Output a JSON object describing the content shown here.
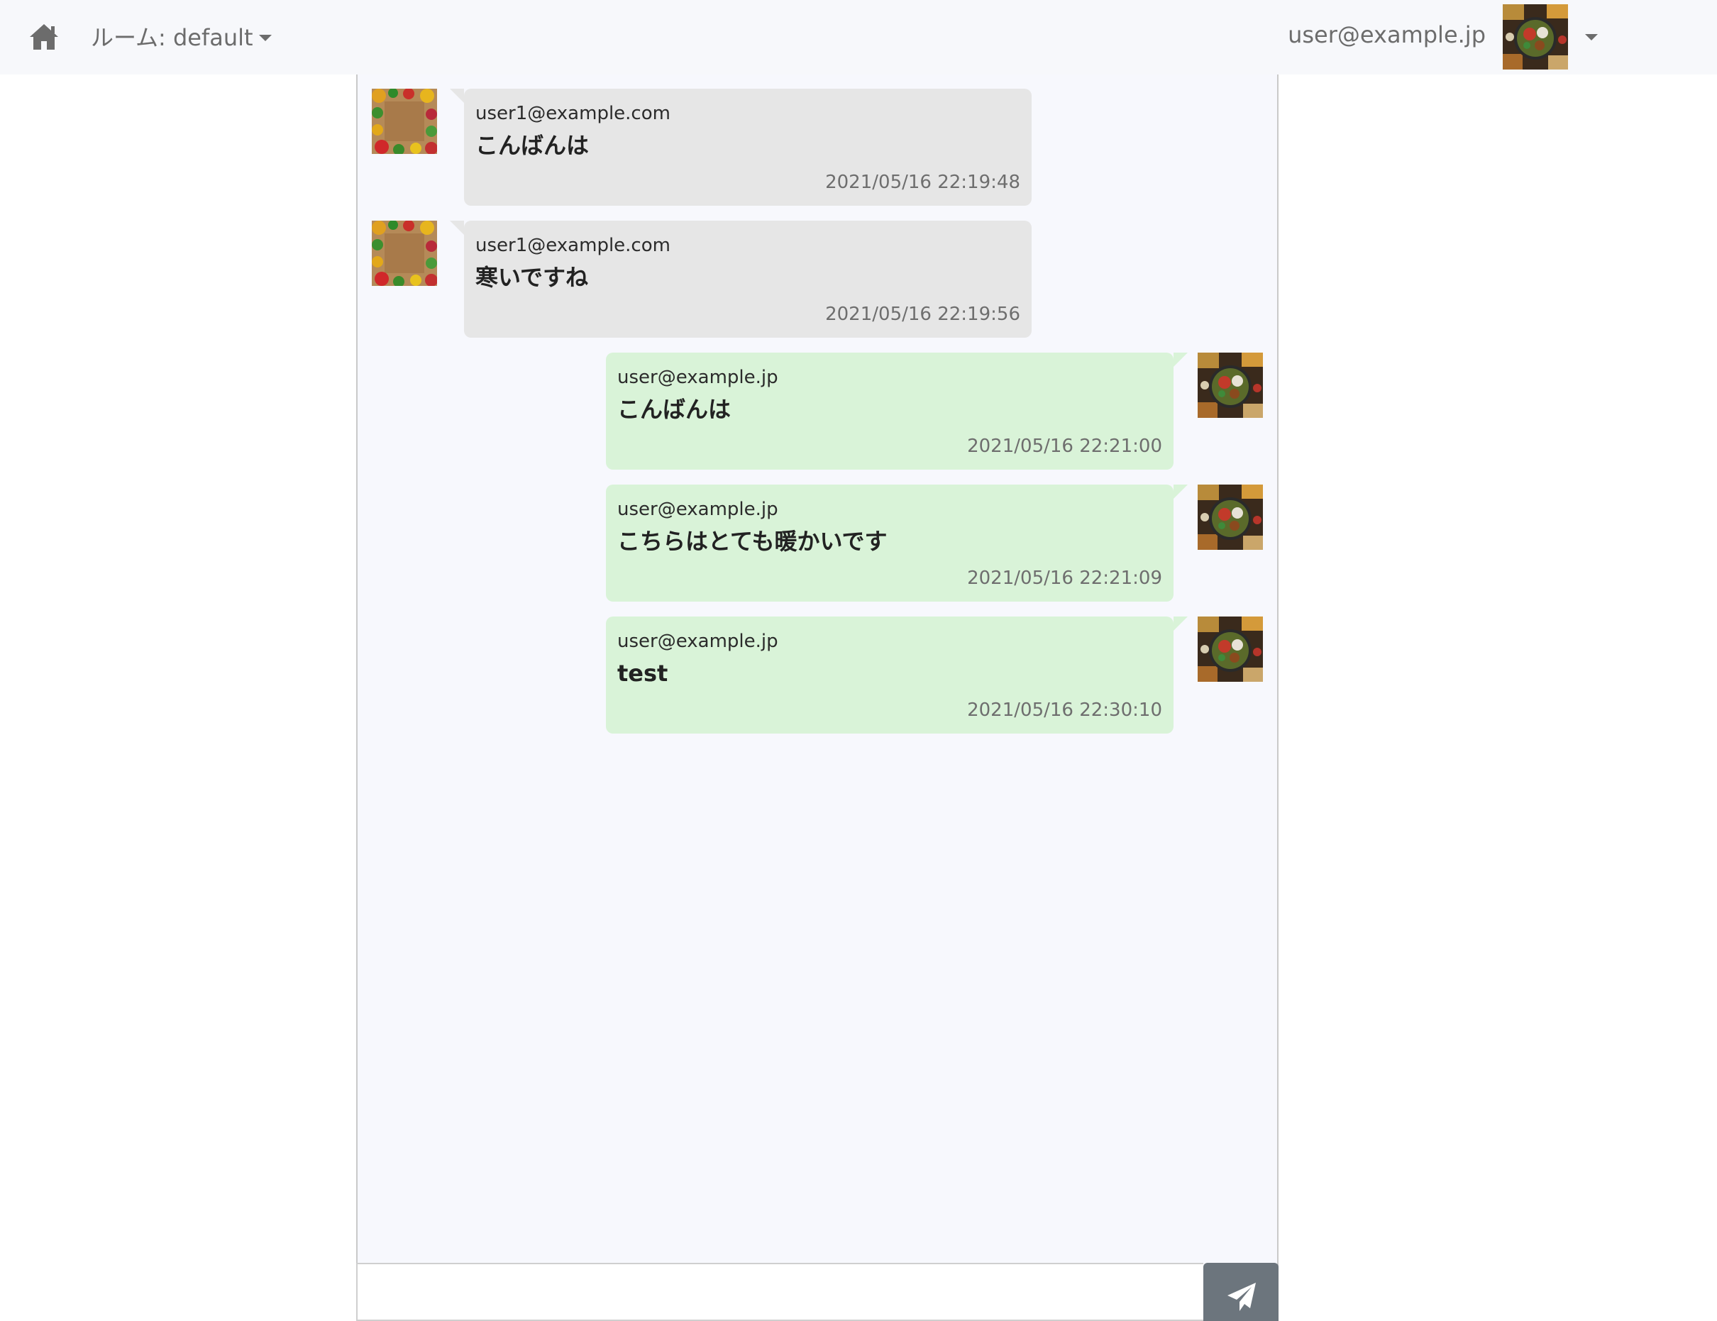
{
  "navbar": {
    "home_icon": "home-icon",
    "room_label": "ルーム: default",
    "user_email": "user@example.jp",
    "user_avatar": "food-bowl-avatar",
    "menu_icon": "caret-down-icon"
  },
  "messages": [
    {
      "side": "left",
      "user": "user1@example.com",
      "text": "こんばんは",
      "time": "2021/05/16  22:19:48",
      "avatar": "vegetables-frame-avatar"
    },
    {
      "side": "left",
      "user": "user1@example.com",
      "text": "寒いですね",
      "time": "2021/05/16  22:19:56",
      "avatar": "vegetables-frame-avatar"
    },
    {
      "side": "right",
      "user": "user@example.jp",
      "text": "こんばんは",
      "time": "2021/05/16  22:21:00",
      "avatar": "food-bowl-avatar"
    },
    {
      "side": "right",
      "user": "user@example.jp",
      "text": "こちらはとても暖かいです",
      "time": "2021/05/16  22:21:09",
      "avatar": "food-bowl-avatar"
    },
    {
      "side": "right",
      "user": "user@example.jp",
      "text": "test",
      "time": "2021/05/16  22:30:10",
      "avatar": "food-bowl-avatar"
    }
  ],
  "input": {
    "value": "",
    "placeholder": "",
    "send_icon": "paper-plane-icon"
  },
  "colors": {
    "navbar_bg": "#f7f8fb",
    "chat_bg": "#f7f8fd",
    "bubble_other": "#e6e6e6",
    "bubble_self": "#d9f3d8",
    "send_button": "#6c757d",
    "nav_text": "#6c6c6c"
  }
}
